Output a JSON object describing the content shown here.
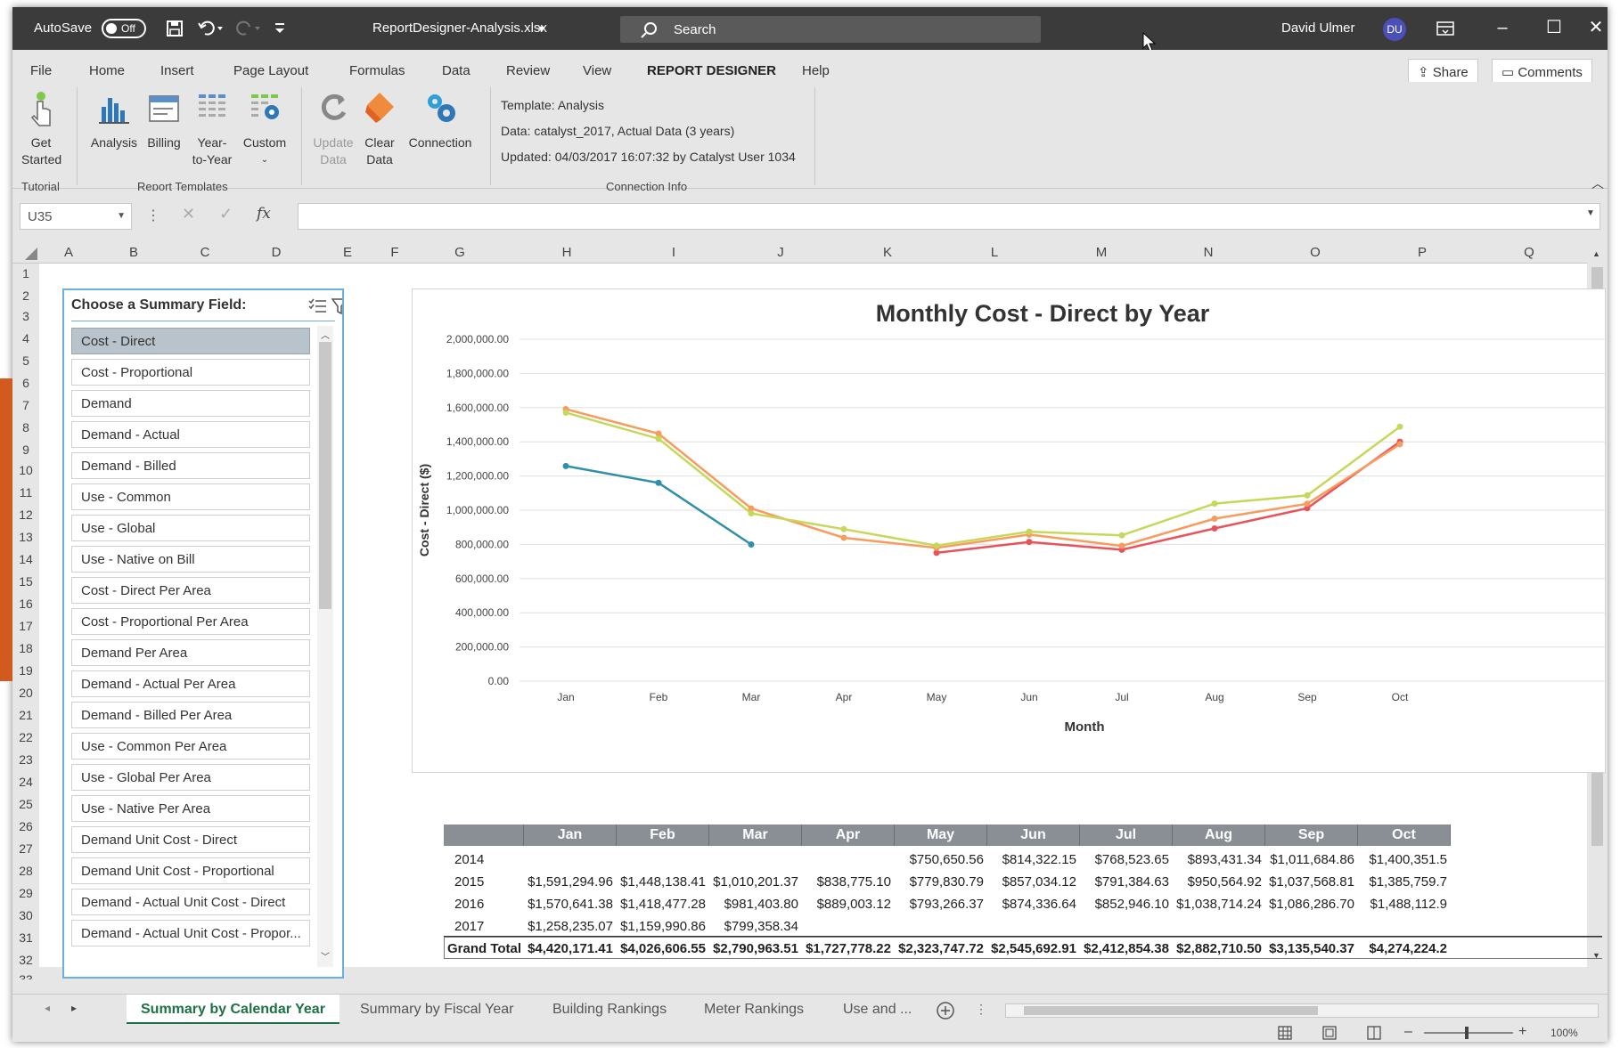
{
  "titlebar": {
    "autosave_label": "AutoSave",
    "autosave_state": "Off",
    "filename": "ReportDesigner-Analysis.xlsx",
    "search_placeholder": "Search",
    "user_name": "David Ulmer",
    "user_initials": "DU"
  },
  "menu": {
    "tabs": [
      "File",
      "Home",
      "Insert",
      "Page Layout",
      "Formulas",
      "Data",
      "Review",
      "View",
      "REPORT DESIGNER",
      "Help"
    ],
    "active_tab": "REPORT DESIGNER",
    "share_label": "Share",
    "comments_label": "Comments"
  },
  "ribbon": {
    "get_started_1": "Get",
    "get_started_2": "Started",
    "analysis": "Analysis",
    "billing": "Billing",
    "year_to_year_1": "Year-",
    "year_to_year_2": "to-Year",
    "custom": "Custom",
    "update_data_1": "Update",
    "update_data_2": "Data",
    "clear_data_1": "Clear",
    "clear_data_2": "Data",
    "connection": "Connection",
    "group_tutorial": "Tutorial",
    "group_templates": "Report Templates",
    "group_connection": "Connection Info",
    "info_template": "Template: Analysis",
    "info_data": "Data: catalyst_2017, Actual Data (3 years)",
    "info_updated": "Updated: 04/03/2017 16:07:32 by Catalyst User 1034"
  },
  "formula_bar": {
    "name_box": "U35",
    "formula": ""
  },
  "columns": [
    "A",
    "B",
    "C",
    "D",
    "E",
    "F",
    "G",
    "H",
    "I",
    "J",
    "K",
    "L",
    "M",
    "N",
    "O",
    "P",
    "Q"
  ],
  "rows": [
    "1",
    "2",
    "3",
    "4",
    "5",
    "6",
    "7",
    "8",
    "9",
    "10",
    "11",
    "12",
    "13",
    "14",
    "15",
    "16",
    "17",
    "18",
    "19",
    "20",
    "21",
    "22",
    "23",
    "24",
    "25",
    "26",
    "27",
    "28",
    "29",
    "30",
    "31",
    "32",
    "33"
  ],
  "slicer": {
    "header": "Choose a Summary Field:",
    "items": [
      "Cost - Direct",
      "Cost - Proportional",
      "Demand",
      "Demand - Actual",
      "Demand - Billed",
      "Use - Common",
      "Use - Global",
      "Use - Native on Bill",
      "Cost - Direct Per Area",
      "Cost - Proportional Per Area",
      "Demand Per Area",
      "Demand - Actual Per Area",
      "Demand - Billed Per Area",
      "Use - Common Per Area",
      "Use - Global Per Area",
      "Use - Native Per Area",
      "Demand Unit Cost - Direct",
      "Demand Unit Cost - Proportional",
      "Demand - Actual Unit Cost - Direct",
      "Demand - Actual Unit Cost - Propor..."
    ],
    "selected_index": 0
  },
  "chart_data": {
    "type": "line",
    "title": "Monthly Cost - Direct by Year",
    "xlabel": "Month",
    "ylabel": "Cost - Direct ($)",
    "ylim": [
      0,
      2000000
    ],
    "yticks": [
      "0.00",
      "200,000.00",
      "400,000.00",
      "600,000.00",
      "800,000.00",
      "1,000,000.00",
      "1,200,000.00",
      "1,400,000.00",
      "1,600,000.00",
      "1,800,000.00",
      "2,000,000.00"
    ],
    "categories": [
      "Jan",
      "Feb",
      "Mar",
      "Apr",
      "May",
      "Jun",
      "Jul",
      "Aug",
      "Sep",
      "Oct"
    ],
    "grid": true,
    "series": [
      {
        "color": "#e8525a",
        "values": [
          null,
          null,
          null,
          null,
          750650.56,
          814322.15,
          768523.65,
          893431.34,
          1011684.86,
          1400351.5
        ]
      },
      {
        "color": "#f79b5e",
        "values": [
          1591294.96,
          1448138.41,
          1010201.37,
          838775.1,
          779830.79,
          857034.12,
          791384.63,
          950564.92,
          1037568.81,
          1385759.7
        ]
      },
      {
        "color": "#c6d75a",
        "values": [
          1570641.38,
          1418477.28,
          981403.8,
          889003.12,
          793266.37,
          874336.64,
          852946.1,
          1038714.24,
          1086286.7,
          1488112.9
        ]
      },
      {
        "color": "#2f8fa8",
        "values": [
          1258235.07,
          1159990.86,
          799358.34,
          null,
          null,
          null,
          null,
          null,
          null,
          null
        ]
      }
    ]
  },
  "pivot": {
    "months": [
      "Jan",
      "Feb",
      "Mar",
      "Apr",
      "May",
      "Jun",
      "Jul",
      "Aug",
      "Sep",
      "Oct"
    ],
    "rows": [
      {
        "label": "2014",
        "cells": [
          "",
          "",
          "",
          "",
          "$750,650.56",
          "$814,322.15",
          "$768,523.65",
          "$893,431.34",
          "$1,011,684.86",
          "$1,400,351.5"
        ]
      },
      {
        "label": "2015",
        "cells": [
          "$1,591,294.96",
          "$1,448,138.41",
          "$1,010,201.37",
          "$838,775.10",
          "$779,830.79",
          "$857,034.12",
          "$791,384.63",
          "$950,564.92",
          "$1,037,568.81",
          "$1,385,759.7"
        ]
      },
      {
        "label": "2016",
        "cells": [
          "$1,570,641.38",
          "$1,418,477.28",
          "$981,403.80",
          "$889,003.12",
          "$793,266.37",
          "$874,336.64",
          "$852,946.10",
          "$1,038,714.24",
          "$1,086,286.70",
          "$1,488,112.9"
        ]
      },
      {
        "label": "2017",
        "cells": [
          "$1,258,235.07",
          "$1,159,990.86",
          "$799,358.34",
          "",
          "",
          "",
          "",
          "",
          "",
          ""
        ]
      },
      {
        "label": "Grand Total",
        "cells": [
          "$4,420,171.41",
          "$4,026,606.55",
          "$2,790,963.51",
          "$1,727,778.22",
          "$2,323,747.72",
          "$2,545,692.91",
          "$2,412,854.38",
          "$2,882,710.50",
          "$3,135,540.37",
          "$4,274,224.2"
        ]
      }
    ]
  },
  "sheet_tabs": [
    "Summary by Calendar Year",
    "Summary by Fiscal Year",
    "Building Rankings",
    "Meter Rankings",
    "Use and ..."
  ],
  "active_sheet": "Summary by Calendar Year",
  "status": {
    "zoom": "100%"
  }
}
